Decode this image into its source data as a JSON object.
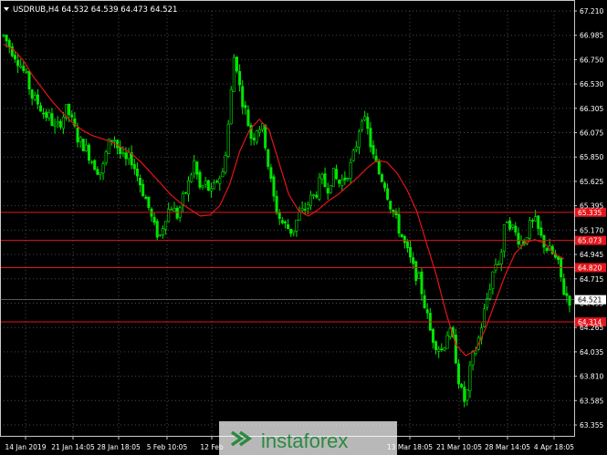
{
  "chart_data": {
    "type": "candlestick",
    "title": "USDRUB,H4  64.532 64.539 64.473 64.521",
    "symbol_menu_icon": "triangle-down-icon",
    "ylim": [
      63.355,
      67.21
    ],
    "y_ticks": [
      "67.210",
      "66.985",
      "66.750",
      "66.530",
      "66.305",
      "66.075",
      "65.850",
      "65.625",
      "65.395",
      "65.170",
      "64.945",
      "64.715",
      "64.495",
      "64.265",
      "64.035",
      "63.810",
      "63.585",
      "63.355"
    ],
    "x_ticks": [
      "14 Jan 2019",
      "21 Jan 14:05",
      "28 Jan 18:05",
      "5 Feb 10:05",
      "12 Feb",
      "13 Mar 18:05",
      "21 Mar 10:05",
      "28 Mar 14:05",
      "4 Apr 18:05"
    ],
    "current_price": "64.521",
    "levels": [
      {
        "value": 65.335,
        "label": "65.335"
      },
      {
        "value": 65.073,
        "label": "65.073"
      },
      {
        "value": 64.82,
        "label": "64.820"
      },
      {
        "value": 64.314,
        "label": "64.314"
      }
    ],
    "close_path": [
      66.98,
      66.88,
      66.8,
      66.7,
      66.58,
      66.4,
      66.35,
      66.25,
      66.22,
      66.1,
      66.2,
      66.3,
      66.15,
      66.0,
      65.95,
      65.85,
      65.75,
      65.7,
      65.95,
      66.05,
      65.9,
      65.8,
      65.85,
      65.7,
      65.55,
      65.4,
      65.2,
      65.1,
      65.3,
      65.4,
      65.3,
      65.45,
      65.6,
      65.8,
      65.55,
      65.6,
      65.5,
      65.65,
      65.7,
      66.2,
      66.85,
      66.45,
      66.25,
      66.0,
      66.15,
      66.1,
      65.7,
      65.4,
      65.25,
      65.2,
      65.15,
      65.3,
      65.35,
      65.45,
      65.5,
      65.65,
      65.55,
      65.7,
      65.6,
      65.65,
      65.75,
      65.95,
      66.25,
      66.1,
      65.85,
      65.7,
      65.6,
      65.4,
      65.25,
      65.1,
      64.95,
      64.8,
      64.7,
      64.45,
      64.2,
      64.1,
      64.05,
      64.25,
      64.1,
      63.7,
      63.55,
      63.95,
      64.1,
      64.35,
      64.6,
      64.85,
      64.9,
      65.3,
      65.2,
      65.1,
      65.05,
      65.2,
      65.25,
      65.1,
      65.0,
      64.95,
      64.85,
      64.6,
      64.52
    ],
    "ma_path": [
      66.9,
      66.85,
      66.75,
      66.6,
      66.48,
      66.36,
      66.26,
      66.17,
      66.1,
      66.05,
      66.02,
      65.99,
      65.94,
      65.88,
      65.8,
      65.7,
      65.6,
      65.5,
      65.42,
      65.36,
      65.3,
      65.31,
      65.4,
      65.6,
      65.9,
      66.1,
      66.2,
      66.1,
      65.8,
      65.5,
      65.35,
      65.3,
      65.36,
      65.44,
      65.5,
      65.58,
      65.66,
      65.75,
      65.82,
      65.8,
      65.7,
      65.55,
      65.35,
      65.05,
      64.75,
      64.4,
      64.1,
      64.0,
      64.05,
      64.25,
      64.5,
      64.75,
      64.95,
      65.05,
      65.08,
      65.05,
      64.95,
      64.9
    ]
  },
  "branding": {
    "text": "instaforex",
    "logo_icon": "instaforex-chevron-logo-icon"
  }
}
